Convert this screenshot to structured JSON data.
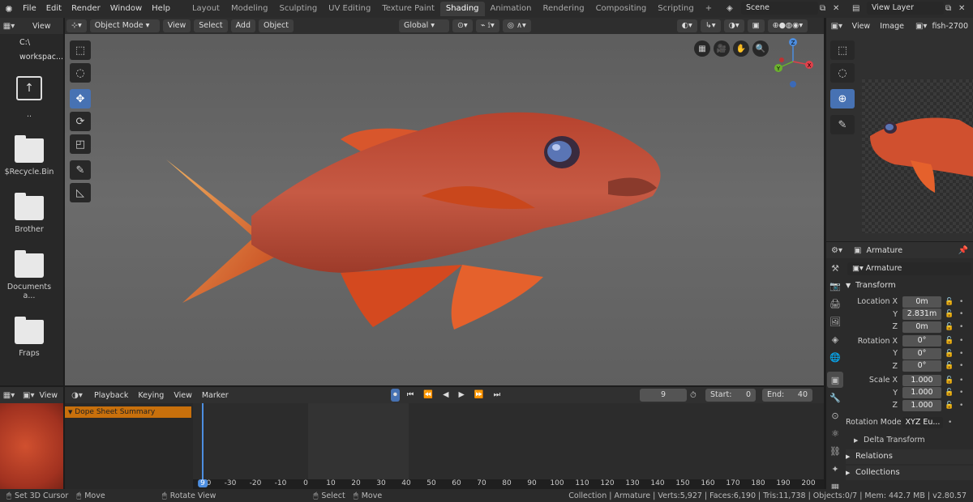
{
  "menus": [
    "File",
    "Edit",
    "Render",
    "Window",
    "Help"
  ],
  "workspaces": [
    "Layout",
    "Modeling",
    "Sculpting",
    "UV Editing",
    "Texture Paint",
    "Shading",
    "Animation",
    "Rendering",
    "Compositing",
    "Scripting",
    "+"
  ],
  "active_workspace": "Shading",
  "scene": "Scene",
  "view_layer": "View Layer",
  "file_browser": {
    "view_label": "View",
    "path": "C:\\",
    "bookmark": "workspac...",
    "up": "..",
    "items": [
      "$Recycle.Bin",
      "Brother",
      "Documents a...",
      "Fraps"
    ]
  },
  "viewport": {
    "mode": "Object Mode",
    "menus": [
      "View",
      "Select",
      "Add",
      "Object"
    ],
    "orientation": "Global",
    "axes": {
      "z": "Z",
      "y": "Y",
      "x": "X"
    }
  },
  "image_editor": {
    "menus": [
      "View",
      "Image"
    ],
    "image_name": "fish-2700"
  },
  "properties": {
    "object_name": "Armature",
    "data_name": "Armature",
    "transform_label": "Transform",
    "location_label": "Location X",
    "location": [
      "0m",
      "2.831m",
      "0m"
    ],
    "rotation_label": "Rotation X",
    "rotation": [
      "0°",
      "0°",
      "0°"
    ],
    "scale_label": "Scale X",
    "scale": [
      "1.000",
      "1.000",
      "1.000"
    ],
    "axis_y": "Y",
    "axis_z": "Z",
    "rotation_mode_label": "Rotation Mode",
    "rotation_mode": "XYZ Eu...",
    "delta_transform": "Delta Transform",
    "relations": "Relations",
    "collections": "Collections"
  },
  "timeline": {
    "view_label": "View",
    "menus": [
      "Playback",
      "Keying",
      "View",
      "Marker"
    ],
    "current_frame": "9",
    "start_label": "Start:",
    "start": "0",
    "end_label": "End:",
    "end": "40",
    "summary": "Dope Sheet Summary",
    "ticks": [
      "-40",
      "-30",
      "-20",
      "-10",
      "0",
      "10",
      "20",
      "30",
      "40",
      "50",
      "60",
      "70",
      "80",
      "90",
      "100",
      "110",
      "120",
      "130",
      "140",
      "150",
      "160",
      "170",
      "180",
      "190",
      "200"
    ],
    "playhead_label": "9"
  },
  "status": {
    "left": [
      "Set 3D Cursor",
      "Move",
      "Rotate View",
      "Select",
      "Move"
    ],
    "right": "Collection | Armature | Verts:5,927 | Faces:6,190 | Tris:11,738 | Objects:0/7 | Mem: 442.7 MB | v2.80.57"
  },
  "colors": {
    "accent": "#4772b3",
    "summary": "#c8700c",
    "playhead": "#4d8ee0",
    "fish": "#c7452e"
  }
}
